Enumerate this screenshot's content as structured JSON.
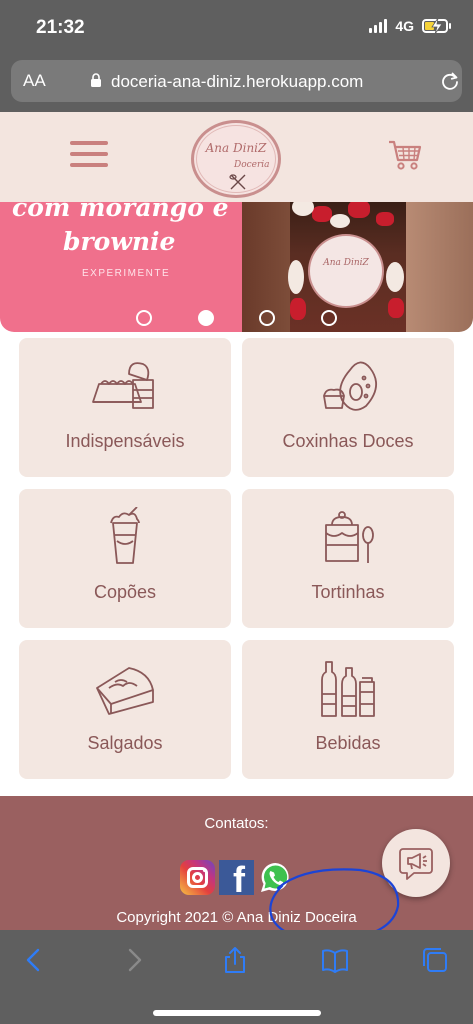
{
  "status_bar": {
    "time": "21:32",
    "network": "4G",
    "battery_level": 0.45
  },
  "browser": {
    "text_size_label": "AA",
    "url": "doceria-ana-diniz.herokuapp.com",
    "icons": {
      "lock": "lock-icon",
      "reload": "reload-icon",
      "back": "back-icon",
      "forward": "forward-icon",
      "share": "share-icon",
      "bookmarks": "bookmarks-icon",
      "tabs": "tabs-icon"
    }
  },
  "header": {
    "logo_name": "Ana DiniZ",
    "logo_subtitle": "Doceria",
    "menu_icon": "hamburger-menu-icon",
    "cart_icon": "shopping-cart-icon"
  },
  "carousel": {
    "headline_line1": "com morango e",
    "headline_line2": "brownie",
    "cta": "EXPERIMENTE",
    "jar_label": "Ana DiniZ",
    "slide_count": 4,
    "active_index": 1
  },
  "categories": [
    {
      "label": "Indispensáveis",
      "icon": "cake-slice-icon"
    },
    {
      "label": "Coxinhas Doces",
      "icon": "avocado-coxinha-icon"
    },
    {
      "label": "Copões",
      "icon": "milkshake-cup-icon"
    },
    {
      "label": "Tortinhas",
      "icon": "dessert-cup-icon"
    },
    {
      "label": "Salgados",
      "icon": "pie-slice-icon"
    },
    {
      "label": "Bebidas",
      "icon": "drinks-bottles-icon"
    }
  ],
  "footer": {
    "contacts_title": "Contatos:",
    "social": [
      "instagram-icon",
      "facebook-icon",
      "whatsapp-icon"
    ],
    "facebook_glyph": "f",
    "copyright": "Copyright 2021 © Ana Diniz Doceira"
  },
  "fab": {
    "icon": "megaphone-icon"
  },
  "colors": {
    "header_bg": "#f3e5df",
    "accent": "#c9807e",
    "card_bg": "#f3e7e1",
    "card_text": "#8a5858",
    "footer_bg": "#9a6060",
    "banner_pink": "#f0708c",
    "annotation_blue": "#1c44d6"
  }
}
